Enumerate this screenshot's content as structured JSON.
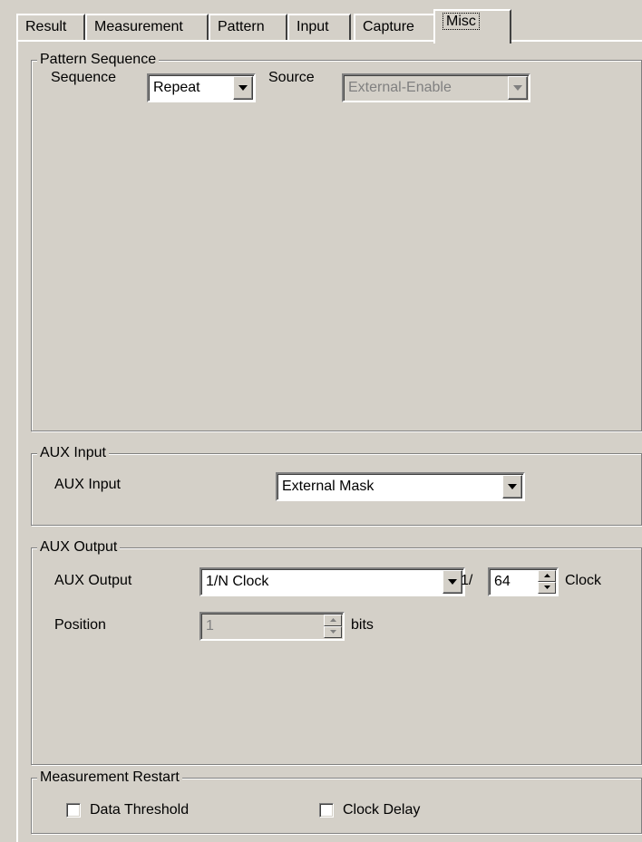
{
  "tabs": [
    "Result",
    "Measurement",
    "Pattern",
    "Input",
    "Capture",
    "Misc"
  ],
  "active_tab": "Misc",
  "pattern_sequence": {
    "group_title": "Pattern Sequence",
    "sequence_label": "Sequence",
    "sequence_value": "Repeat",
    "source_label": "Source",
    "source_value": "External-Enable"
  },
  "aux_input": {
    "group_title": "AUX Input",
    "label": "AUX Input",
    "value": "External Mask"
  },
  "aux_output": {
    "group_title": "AUX Output",
    "label": "AUX Output",
    "value": "1/N Clock",
    "divider_prefix": "1/",
    "divider_value": "64",
    "divider_suffix": "Clock",
    "position_label": "Position",
    "position_value": "1",
    "position_unit": "bits"
  },
  "measurement_restart": {
    "group_title": "Measurement Restart",
    "data_threshold_label": "Data Threshold",
    "data_threshold_checked": false,
    "clock_delay_label": "Clock Delay",
    "clock_delay_checked": false
  },
  "icons": {
    "dropdown_arrow": "chevron-down-icon",
    "spin_up": "spin-up-arrow-icon",
    "spin_down": "spin-down-arrow-icon"
  }
}
